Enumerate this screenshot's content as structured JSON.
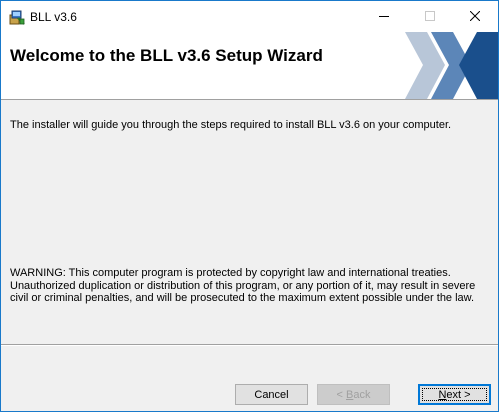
{
  "window": {
    "title": "BLL v3.6",
    "app_icon": "installer-package-icon",
    "controls": {
      "minimize_icon": "minimize-icon",
      "maximize_icon": "maximize-icon",
      "close_icon": "close-icon"
    }
  },
  "banner": {
    "title": "Welcome to the BLL v3.6 Setup Wizard",
    "logo_icon": "chevron-x-logo-icon"
  },
  "body": {
    "intro": "The installer will guide you through the steps required to install BLL v3.6 on your computer.",
    "warning": "WARNING: This computer program is protected by copyright law and international treaties. Unauthorized duplication or distribution of this program, or any portion of it, may result in severe civil or criminal penalties, and will be prosecuted to the maximum extent possible under the law."
  },
  "buttons": {
    "cancel": "Cancel",
    "back_prefix": "< ",
    "back_accel": "B",
    "back_rest": "ack",
    "next_accel": "N",
    "next_rest": "ext >"
  },
  "colors": {
    "window_border": "#1979ca",
    "logo_light": "#b8c6d8",
    "logo_mid": "#5c86b8",
    "logo_dark": "#1a4f8c",
    "focus_border": "#0078d7"
  }
}
